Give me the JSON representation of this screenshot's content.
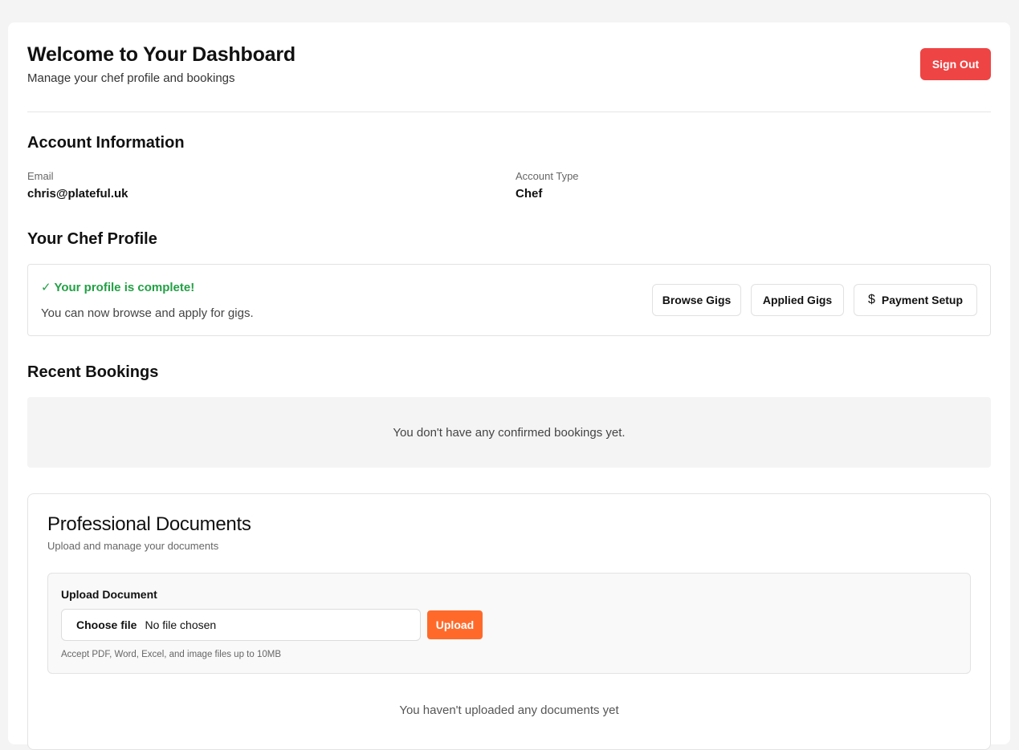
{
  "header": {
    "title": "Welcome to Your Dashboard",
    "subtitle": "Manage your chef profile and bookings",
    "signout_label": "Sign Out"
  },
  "account": {
    "section_title": "Account Information",
    "email_label": "Email",
    "email_value": "chris@plateful.uk",
    "type_label": "Account Type",
    "type_value": "Chef"
  },
  "profile": {
    "section_title": "Your Chef Profile",
    "status": "✓ Your profile is complete!",
    "description": "You can now browse and apply for gigs.",
    "buttons": {
      "browse": "Browse Gigs",
      "applied": "Applied Gigs",
      "payment": "Payment Setup"
    },
    "payment_icon": "dollar-icon"
  },
  "bookings": {
    "section_title": "Recent Bookings",
    "empty_message": "You don't have any confirmed bookings yet."
  },
  "documents": {
    "title": "Professional Documents",
    "subtitle": "Upload and manage your documents",
    "upload_label": "Upload Document",
    "choose_file_label": "Choose file",
    "file_status": "No file chosen",
    "upload_button": "Upload",
    "hint": "Accept PDF, Word, Excel, and image files up to 10MB",
    "empty_message": "You haven't uploaded any documents yet"
  },
  "colors": {
    "danger": "#ef4444",
    "success": "#22a045",
    "accent": "#ff6a2b"
  }
}
